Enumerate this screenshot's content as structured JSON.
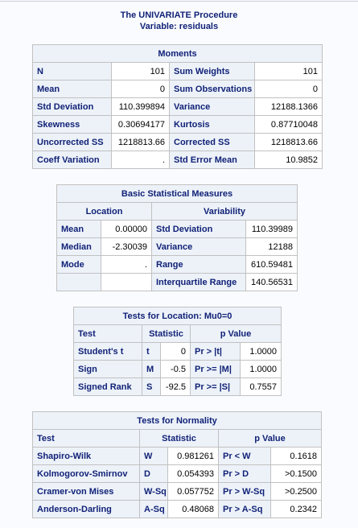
{
  "header": {
    "title": "The UNIVARIATE Procedure",
    "variable": "Variable: residuals"
  },
  "moments": {
    "caption": "Moments",
    "rows": [
      {
        "l1": "N",
        "v1": "101",
        "l2": "Sum Weights",
        "v2": "101"
      },
      {
        "l1": "Mean",
        "v1": "0",
        "l2": "Sum Observations",
        "v2": "0"
      },
      {
        "l1": "Std Deviation",
        "v1": "110.399894",
        "l2": "Variance",
        "v2": "12188.1366"
      },
      {
        "l1": "Skewness",
        "v1": "0.30694177",
        "l2": "Kurtosis",
        "v2": "0.87710048"
      },
      {
        "l1": "Uncorrected SS",
        "v1": "1218813.66",
        "l2": "Corrected SS",
        "v2": "1218813.66"
      },
      {
        "l1": "Coeff Variation",
        "v1": ".",
        "l2": "Std Error Mean",
        "v2": "10.9852"
      }
    ]
  },
  "basic": {
    "caption": "Basic Statistical Measures",
    "location_header": "Location",
    "variability_header": "Variability",
    "rows": [
      {
        "l1": "Mean",
        "v1": "0.00000",
        "l2": "Std Deviation",
        "v2": "110.39989"
      },
      {
        "l1": "Median",
        "v1": "-2.30039",
        "l2": "Variance",
        "v2": "12188"
      },
      {
        "l1": "Mode",
        "v1": ".",
        "l2": "Range",
        "v2": "610.59481"
      },
      {
        "l1": "",
        "v1": "",
        "l2": "Interquartile Range",
        "v2": "140.56531"
      }
    ]
  },
  "location_tests": {
    "caption": "Tests for Location: Mu0=0",
    "headers": {
      "test": "Test",
      "statistic": "Statistic",
      "pvalue": "p Value"
    },
    "rows": [
      {
        "test": "Student's t",
        "sym": "t",
        "stat": "0",
        "plabel": "Pr > |t|",
        "pval": "1.0000"
      },
      {
        "test": "Sign",
        "sym": "M",
        "stat": "-0.5",
        "plabel": "Pr >= |M|",
        "pval": "1.0000"
      },
      {
        "test": "Signed Rank",
        "sym": "S",
        "stat": "-92.5",
        "plabel": "Pr >= |S|",
        "pval": "0.7557"
      }
    ]
  },
  "normality_tests": {
    "caption": "Tests for Normality",
    "headers": {
      "test": "Test",
      "statistic": "Statistic",
      "pvalue": "p Value"
    },
    "rows": [
      {
        "test": "Shapiro-Wilk",
        "sym": "W",
        "stat": "0.981261",
        "plabel": "Pr < W",
        "pval": "0.1618"
      },
      {
        "test": "Kolmogorov-Smirnov",
        "sym": "D",
        "stat": "0.054393",
        "plabel": "Pr > D",
        "pval": ">0.1500"
      },
      {
        "test": "Cramer-von Mises",
        "sym": "W-Sq",
        "stat": "0.057752",
        "plabel": "Pr > W-Sq",
        "pval": ">0.2500"
      },
      {
        "test": "Anderson-Darling",
        "sym": "A-Sq",
        "stat": "0.48068",
        "plabel": "Pr > A-Sq",
        "pval": "0.2342"
      }
    ]
  }
}
